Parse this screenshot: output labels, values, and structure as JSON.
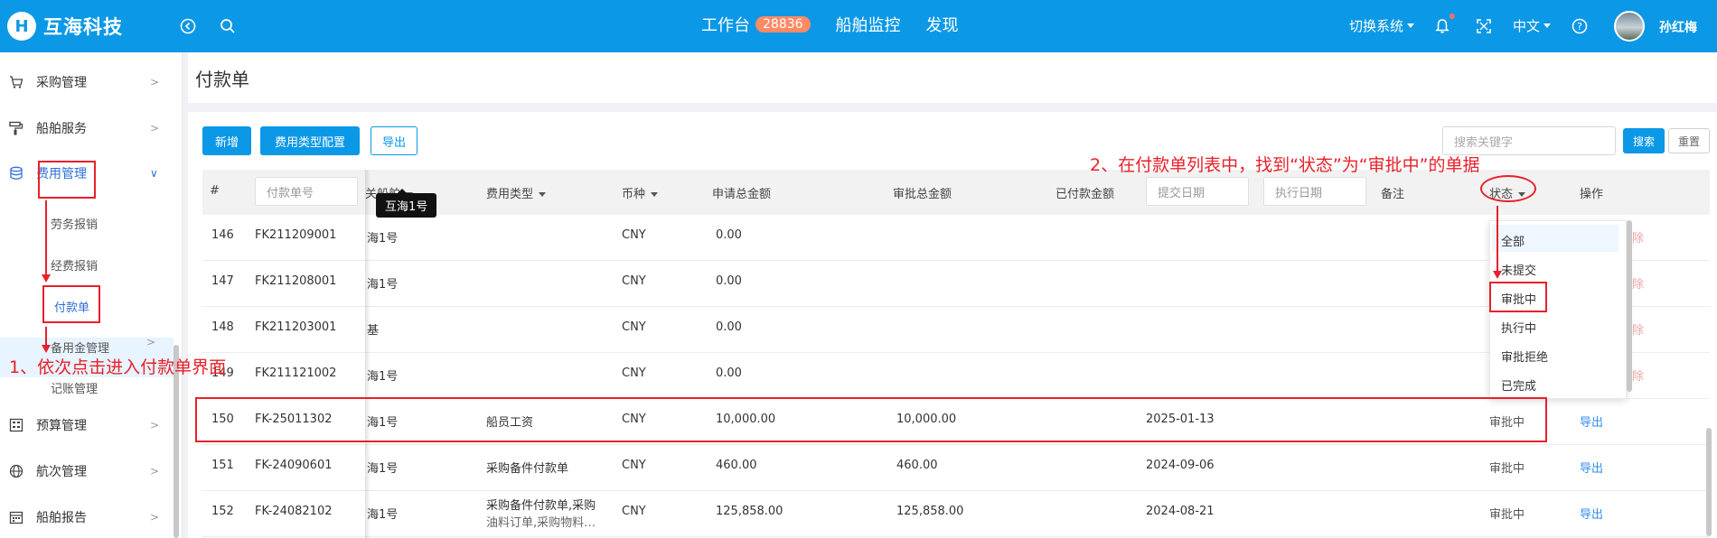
{
  "header": {
    "logo_text": "互海科技",
    "nav": [
      {
        "label": "工作台",
        "badge": "28836"
      },
      {
        "label": "船舶监控"
      },
      {
        "label": "发现"
      }
    ],
    "switch_system": "切换系统",
    "language": "中文",
    "username": "孙红梅"
  },
  "sidebar": {
    "items": [
      {
        "label": "采购管理",
        "icon": "cart-icon"
      },
      {
        "label": "船舶服务",
        "icon": "paint-roller-icon"
      },
      {
        "label": "费用管理",
        "icon": "database-icon"
      },
      {
        "label": "预算管理",
        "icon": "calculator-icon"
      },
      {
        "label": "航次管理",
        "icon": "globe-icon"
      },
      {
        "label": "船舶报告",
        "icon": "calendar-icon"
      }
    ],
    "sub_items": [
      "劳务报销",
      "经费报销",
      "付款单",
      "备用金管理",
      "记账管理"
    ]
  },
  "page": {
    "title": "付款单",
    "buttons": {
      "add": "新增",
      "fee_config": "费用类型配置",
      "export": "导出",
      "search": "搜索",
      "reset": "重置"
    },
    "search_placeholder": "搜索关键字"
  },
  "table": {
    "columns": [
      "#",
      "付款单号",
      "关船舶",
      "费用类型",
      "币种",
      "申请总金额",
      "审批总金额",
      "已付款金额",
      "提交日期",
      "执行日期",
      "备注",
      "状态",
      "操作"
    ],
    "rows": [
      {
        "no": "146",
        "code": "FK211209001",
        "ship": "海1号",
        "fee_type": "",
        "currency": "CNY",
        "apply": "0.00",
        "approve": "",
        "date": "",
        "status": "",
        "action": "除"
      },
      {
        "no": "147",
        "code": "FK211208001",
        "ship": "海1号",
        "fee_type": "",
        "currency": "CNY",
        "apply": "0.00",
        "approve": "",
        "date": "",
        "status": "",
        "action": "除"
      },
      {
        "no": "148",
        "code": "FK211203001",
        "ship": "基",
        "fee_type": "",
        "currency": "CNY",
        "apply": "0.00",
        "approve": "",
        "date": "",
        "status": "",
        "action": "除"
      },
      {
        "no": "149",
        "code": "FK211121002",
        "ship": "海1号",
        "fee_type": "",
        "currency": "CNY",
        "apply": "0.00",
        "approve": "",
        "date": "",
        "status": "",
        "action": "除"
      },
      {
        "no": "150",
        "code": "FK-25011302",
        "ship": "海1号",
        "fee_type": "船员工资",
        "currency": "CNY",
        "apply": "10,000.00",
        "approve": "10,000.00",
        "date": "2025-01-13",
        "status": "审批中",
        "action": "导出"
      },
      {
        "no": "151",
        "code": "FK-24090601",
        "ship": "海1号",
        "fee_type": "采购备件付款单",
        "currency": "CNY",
        "apply": "460.00",
        "approve": "460.00",
        "date": "2024-09-06",
        "status": "审批中",
        "action": "导出"
      },
      {
        "no": "152",
        "code": "FK-24082102",
        "ship": "海1号",
        "fee_type": "采购备件付款单,采购",
        "fee_type2": "油料订单,采购物料…",
        "currency": "CNY",
        "apply": "125,858.00",
        "approve": "125,858.00",
        "date": "2024-08-21",
        "status": "审批中",
        "action": "导出"
      }
    ]
  },
  "tooltip": "互海1号",
  "status_dropdown": [
    "全部",
    "未提交",
    "审批中",
    "执行中",
    "审批拒绝",
    "已完成"
  ],
  "annotations": {
    "step1": "1、依次点击进入付款单界面",
    "step2": "2、在付款单列表中，找到“状态”为“审批中”的单据"
  },
  "colors": {
    "brand": "#0b98e6",
    "annotation": "#e8212a",
    "link": "#2d8cf0"
  }
}
